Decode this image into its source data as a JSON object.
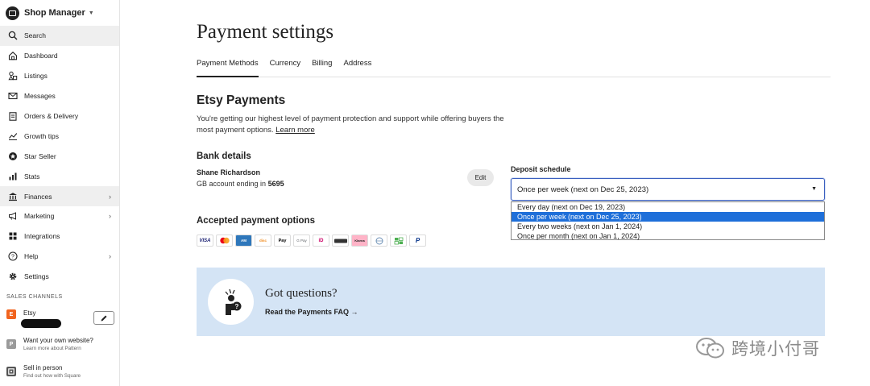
{
  "sidebar": {
    "title": "Shop Manager",
    "items": [
      {
        "label": "Search",
        "icon": "search-icon"
      },
      {
        "label": "Dashboard",
        "icon": "home-icon"
      },
      {
        "label": "Listings",
        "icon": "listings-icon"
      },
      {
        "label": "Messages",
        "icon": "mail-icon"
      },
      {
        "label": "Orders & Delivery",
        "icon": "clipboard-icon"
      },
      {
        "label": "Growth tips",
        "icon": "growth-icon"
      },
      {
        "label": "Star Seller",
        "icon": "star-icon"
      },
      {
        "label": "Stats",
        "icon": "stats-icon"
      },
      {
        "label": "Finances",
        "icon": "bank-icon"
      },
      {
        "label": "Marketing",
        "icon": "megaphone-icon"
      },
      {
        "label": "Integrations",
        "icon": "grid-icon"
      },
      {
        "label": "Help",
        "icon": "help-icon"
      },
      {
        "label": "Settings",
        "icon": "gear-icon"
      }
    ],
    "sales_channels_heading": "SALES CHANNELS",
    "channels": [
      {
        "badge": "E",
        "title": "Etsy",
        "subtitle": "",
        "color": "#f1641e"
      },
      {
        "badge": "P",
        "title": "Want your own website?",
        "subtitle": "Learn more about Pattern",
        "color": "#9a9a9a"
      },
      {
        "badge": "",
        "title": "Sell in person",
        "subtitle": "Find out how with Square",
        "color": "#555555"
      }
    ]
  },
  "main": {
    "title": "Payment settings",
    "tabs": [
      "Payment Methods",
      "Currency",
      "Billing",
      "Address"
    ],
    "etsy_payments": {
      "title": "Etsy Payments",
      "description": "You're getting our highest level of payment protection and support while offering buyers the most payment options.",
      "learn_more": "Learn more"
    },
    "bank": {
      "heading": "Bank details",
      "name": "Shane Richardson",
      "account_prefix": "GB account ending in",
      "account_last4": "5695",
      "edit_label": "Edit"
    },
    "deposit": {
      "label": "Deposit schedule",
      "selected": "Once per week (next on Dec 25, 2023)",
      "options": [
        "Every day (next on Dec 19, 2023)",
        "Once per week (next on Dec 25, 2023)",
        "Every two weeks (next on Jan 1, 2024)",
        "Once per month (next on Jan 1, 2024)"
      ]
    },
    "accepted": {
      "heading": "Accepted payment options",
      "methods": [
        {
          "name": "visa",
          "label": "VISA",
          "color": "#1a1f71"
        },
        {
          "name": "mastercard",
          "label": "",
          "color": "#eb001b"
        },
        {
          "name": "amex",
          "label": "AM",
          "color": "#2e77bb"
        },
        {
          "name": "discover",
          "label": "disc",
          "color": "#f08a1c"
        },
        {
          "name": "apple-pay",
          "label": "Pay",
          "color": "#000000"
        },
        {
          "name": "google-pay",
          "label": "G Pay",
          "color": "#5f6368"
        },
        {
          "name": "ideal",
          "label": "iD",
          "color": "#cc0066"
        },
        {
          "name": "sofort",
          "label": "",
          "color": "#333333"
        },
        {
          "name": "klarna",
          "label": "Klarna",
          "color": "#ffb3c7"
        },
        {
          "name": "gift-card",
          "label": "",
          "color": "#6b8fb5"
        },
        {
          "name": "store-credit",
          "label": "",
          "color": "#4caf50"
        },
        {
          "name": "paypal",
          "label": "P",
          "color": "#003087"
        }
      ]
    },
    "faq": {
      "title": "Got questions?",
      "link": "Read the Payments FAQ →"
    }
  },
  "watermark": "跨境小付哥"
}
